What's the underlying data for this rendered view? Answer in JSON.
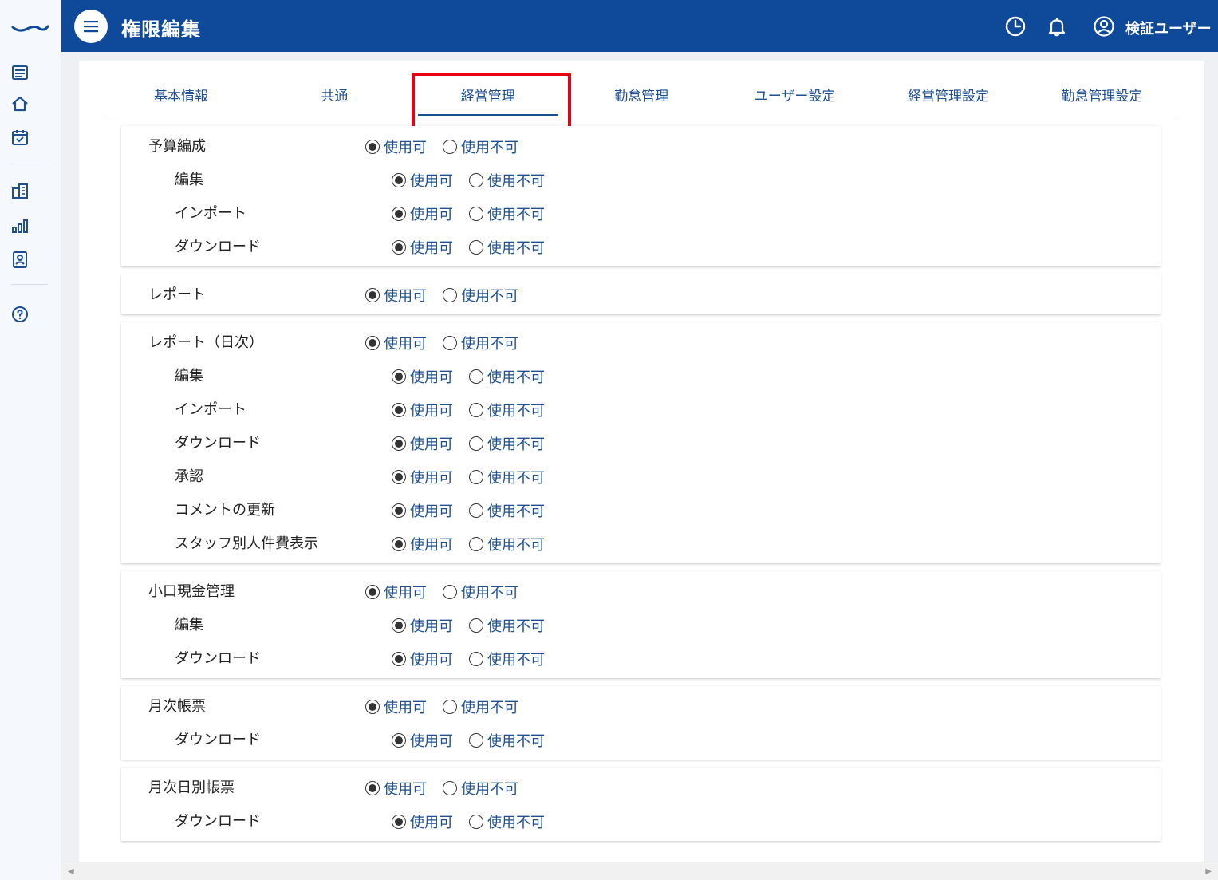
{
  "header": {
    "title": "権限編集",
    "user_name": "検証ユーザー",
    "icons": [
      "menu-icon",
      "clock-icon",
      "bell-icon",
      "user-circle-icon"
    ]
  },
  "sidebar": {
    "icons": [
      "logo",
      "list-icon",
      "home-icon",
      "calendar-check-icon",
      "building-icon",
      "bar-chart-icon",
      "id-badge-icon",
      "help-icon"
    ]
  },
  "tabs": [
    {
      "label": "基本情報",
      "active": false
    },
    {
      "label": "共通",
      "active": false
    },
    {
      "label": "経営管理",
      "active": true
    },
    {
      "label": "勤怠管理",
      "active": false
    },
    {
      "label": "ユーザー設定",
      "active": false
    },
    {
      "label": "経営管理設定",
      "active": false
    },
    {
      "label": "勤怠管理設定",
      "active": false
    }
  ],
  "options": {
    "allow": "使用可",
    "deny": "使用不可"
  },
  "sections": [
    {
      "label": "予算編成",
      "value": "allow",
      "children": [
        {
          "label": "編集",
          "value": "allow"
        },
        {
          "label": "インポート",
          "value": "allow"
        },
        {
          "label": "ダウンロード",
          "value": "allow"
        }
      ]
    },
    {
      "label": "レポート",
      "value": "allow",
      "children": []
    },
    {
      "label": "レポート（日次）",
      "value": "allow",
      "children": [
        {
          "label": "編集",
          "value": "allow"
        },
        {
          "label": "インポート",
          "value": "allow"
        },
        {
          "label": "ダウンロード",
          "value": "allow"
        },
        {
          "label": "承認",
          "value": "allow"
        },
        {
          "label": "コメントの更新",
          "value": "allow"
        },
        {
          "label": "スタッフ別人件費表示",
          "value": "allow"
        }
      ]
    },
    {
      "label": "小口現金管理",
      "value": "allow",
      "children": [
        {
          "label": "編集",
          "value": "allow"
        },
        {
          "label": "ダウンロード",
          "value": "allow"
        }
      ]
    },
    {
      "label": "月次帳票",
      "value": "allow",
      "children": [
        {
          "label": "ダウンロード",
          "value": "allow"
        }
      ]
    },
    {
      "label": "月次日別帳票",
      "value": "allow",
      "children": [
        {
          "label": "ダウンロード",
          "value": "allow"
        }
      ]
    }
  ],
  "colors": {
    "header_bg": "#0f4a9a",
    "accent": "#1d4f91",
    "highlight": "#e60012"
  }
}
